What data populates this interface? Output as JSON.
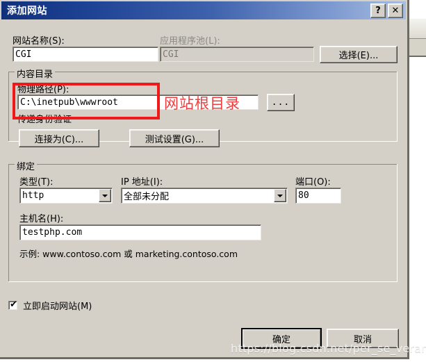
{
  "window": {
    "title": "添加网站",
    "help_button": "?",
    "close_button": "✕"
  },
  "form": {
    "site_name_label": "网站名称(S):",
    "site_name_value": "CGI",
    "app_pool_label": "应用程序池(L):",
    "app_pool_value": "CGI",
    "select_button": "选择(E)..."
  },
  "content_directory": {
    "group_title": "内容目录",
    "physical_path_label": "物理路径(P):",
    "physical_path_value": "C:\\inetpub\\wwwroot",
    "browse_button": "...",
    "pass_through_auth_label": "传递身份验证",
    "connect_as_button": "连接为(C)...",
    "test_settings_button": "测试设置(G)..."
  },
  "binding": {
    "group_title": "绑定",
    "type_label": "类型(T):",
    "type_value": "http",
    "ip_label": "IP 地址(I):",
    "ip_value": "全部未分配",
    "port_label": "端口(O):",
    "port_value": "80",
    "host_label": "主机名(H):",
    "host_value": "testphp.com",
    "example_text": "示例: www.contoso.com 或 marketing.contoso.com"
  },
  "footer": {
    "start_now_label": "立即启动网站(M)",
    "start_now_checked": "✔",
    "ok_button": "确定",
    "cancel_button": "取消"
  },
  "annotation": {
    "text": "网站根目录",
    "color": "#f03c3c"
  },
  "watermark": {
    "text": "https://blog.csdn.net/per_se_veran_ce"
  }
}
